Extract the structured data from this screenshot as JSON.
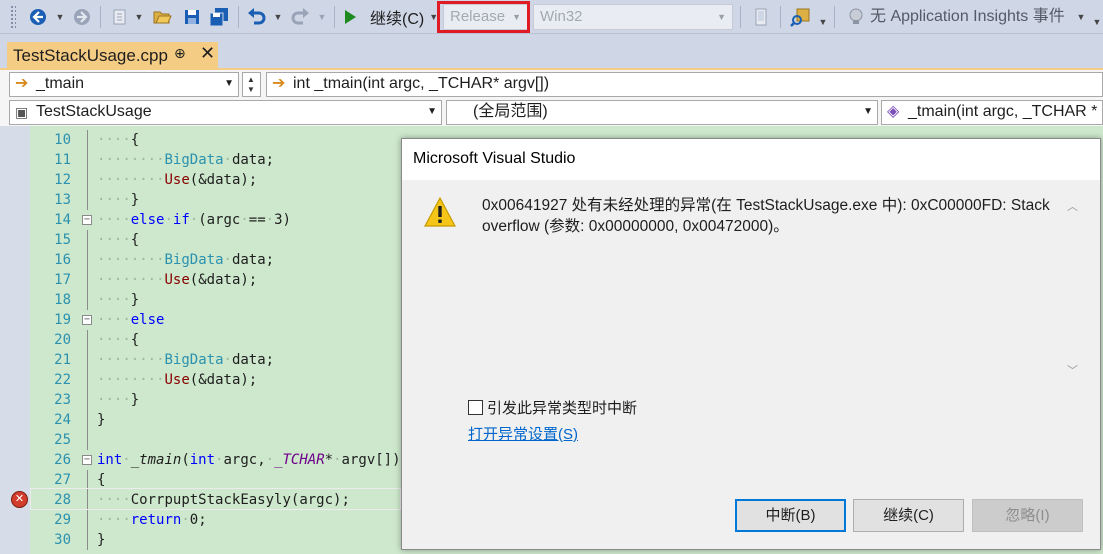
{
  "toolbar": {
    "continue_label": "继续(C)",
    "config_value": "Release",
    "platform_value": "Win32",
    "insights_label": "无 Application Insights 事件"
  },
  "tab": {
    "label": "TestStackUsage.cpp",
    "pin": "⊕",
    "close": "✕"
  },
  "nav": {
    "scope_left": "_tmain",
    "scope_right": "int _tmain(int argc, _TCHAR* argv[])",
    "project": "TestStackUsage",
    "global_scope": "(全局范围)",
    "member": "_tmain(int argc, _TCHAR * a"
  },
  "code_lines": [
    {
      "n": "10",
      "text": "····{"
    },
    {
      "n": "11",
      "text": "········BigData·data;"
    },
    {
      "n": "12",
      "text": "········Use(&data);"
    },
    {
      "n": "13",
      "text": "····}"
    },
    {
      "n": "14",
      "text": "····else·if·(argc·==·3)"
    },
    {
      "n": "15",
      "text": "····{"
    },
    {
      "n": "16",
      "text": "········BigData·data;"
    },
    {
      "n": "17",
      "text": "········Use(&data);"
    },
    {
      "n": "18",
      "text": "····}"
    },
    {
      "n": "19",
      "text": "····else"
    },
    {
      "n": "20",
      "text": "····{"
    },
    {
      "n": "21",
      "text": "········BigData·data;"
    },
    {
      "n": "22",
      "text": "········Use(&data);"
    },
    {
      "n": "23",
      "text": "····}"
    },
    {
      "n": "24",
      "text": "}"
    },
    {
      "n": "25",
      "text": ""
    },
    {
      "n": "26",
      "text": "int·_tmain(int·argc,·_TCHAR*·argv[])"
    },
    {
      "n": "27",
      "text": "{"
    },
    {
      "n": "28",
      "text": "····CorrpuptStackEasyly(argc);"
    },
    {
      "n": "29",
      "text": "····return·0;"
    },
    {
      "n": "30",
      "text": "}"
    }
  ],
  "dialog": {
    "title": "Microsoft Visual Studio",
    "message": "0x00641927 处有未经处理的异常(在 TestStackUsage.exe 中): 0xC00000FD: Stack overflow (参数: 0x00000000, 0x00472000)。",
    "checkbox_label": "引发此异常类型时中断",
    "link": "打开异常设置(S)",
    "break_button": "中断(B)",
    "continue_button": "继续(C)",
    "ignore_button": "忽略(I)"
  },
  "colors": {
    "toolbar_bg": "#cfd6e5",
    "tab_active": "#f5cc84",
    "code_bg": "#cde8cc",
    "highlight_red": "#e01b24",
    "link_blue": "#0066cc"
  }
}
